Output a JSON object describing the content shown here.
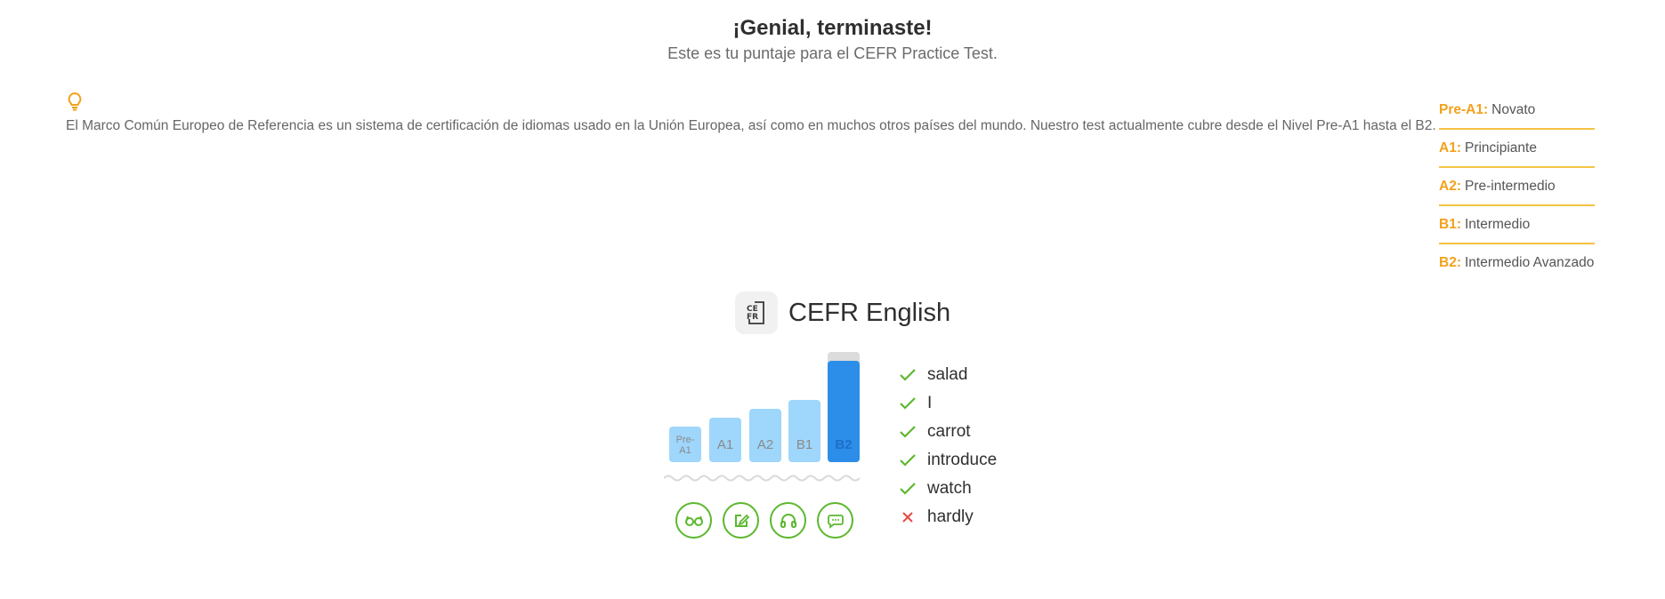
{
  "header": {
    "title": "¡Genial, terminaste!",
    "subtitle": "Este es tu puntaje para el CEFR Practice Test."
  },
  "info": {
    "icon": "lightbulb-icon",
    "description": "El Marco Común Europeo de Referencia es un sistema de certificación de idiomas usado en la Unión Europea, así como en muchos otros países del mundo. Nuestro test actualmente cubre desde el Nivel Pre-A1 hasta el B2."
  },
  "levels": [
    {
      "code": "Pre-A1:",
      "name": "Novato"
    },
    {
      "code": "A1:",
      "name": "Principiante"
    },
    {
      "code": "A2:",
      "name": "Pre-intermedio"
    },
    {
      "code": "B1:",
      "name": "Intermedio"
    },
    {
      "code": "B2:",
      "name": "Intermedio Avanzado"
    }
  ],
  "exam": {
    "icon_text_top": "CE",
    "icon_text_bottom": "FR",
    "title": "CEFR English",
    "achieved_level": "B2",
    "bar_labels": [
      "Pre-\nA1",
      "A1",
      "A2",
      "B1",
      "B2"
    ],
    "skill_icons": [
      "reading-glasses-icon",
      "writing-pen-icon",
      "listening-headphones-icon",
      "speaking-chat-icon"
    ]
  },
  "words": [
    {
      "word": "salad",
      "correct": true
    },
    {
      "word": "I",
      "correct": true
    },
    {
      "word": "carrot",
      "correct": true
    },
    {
      "word": "introduce",
      "correct": true
    },
    {
      "word": "watch",
      "correct": true
    },
    {
      "word": "hardly",
      "correct": false
    }
  ],
  "colors": {
    "accent_orange": "#f2a11b",
    "bar_light": "#9fd6fb",
    "bar_active": "#2c8ee8",
    "correct_green": "#5cb82e",
    "wrong_red": "#e8463f"
  }
}
